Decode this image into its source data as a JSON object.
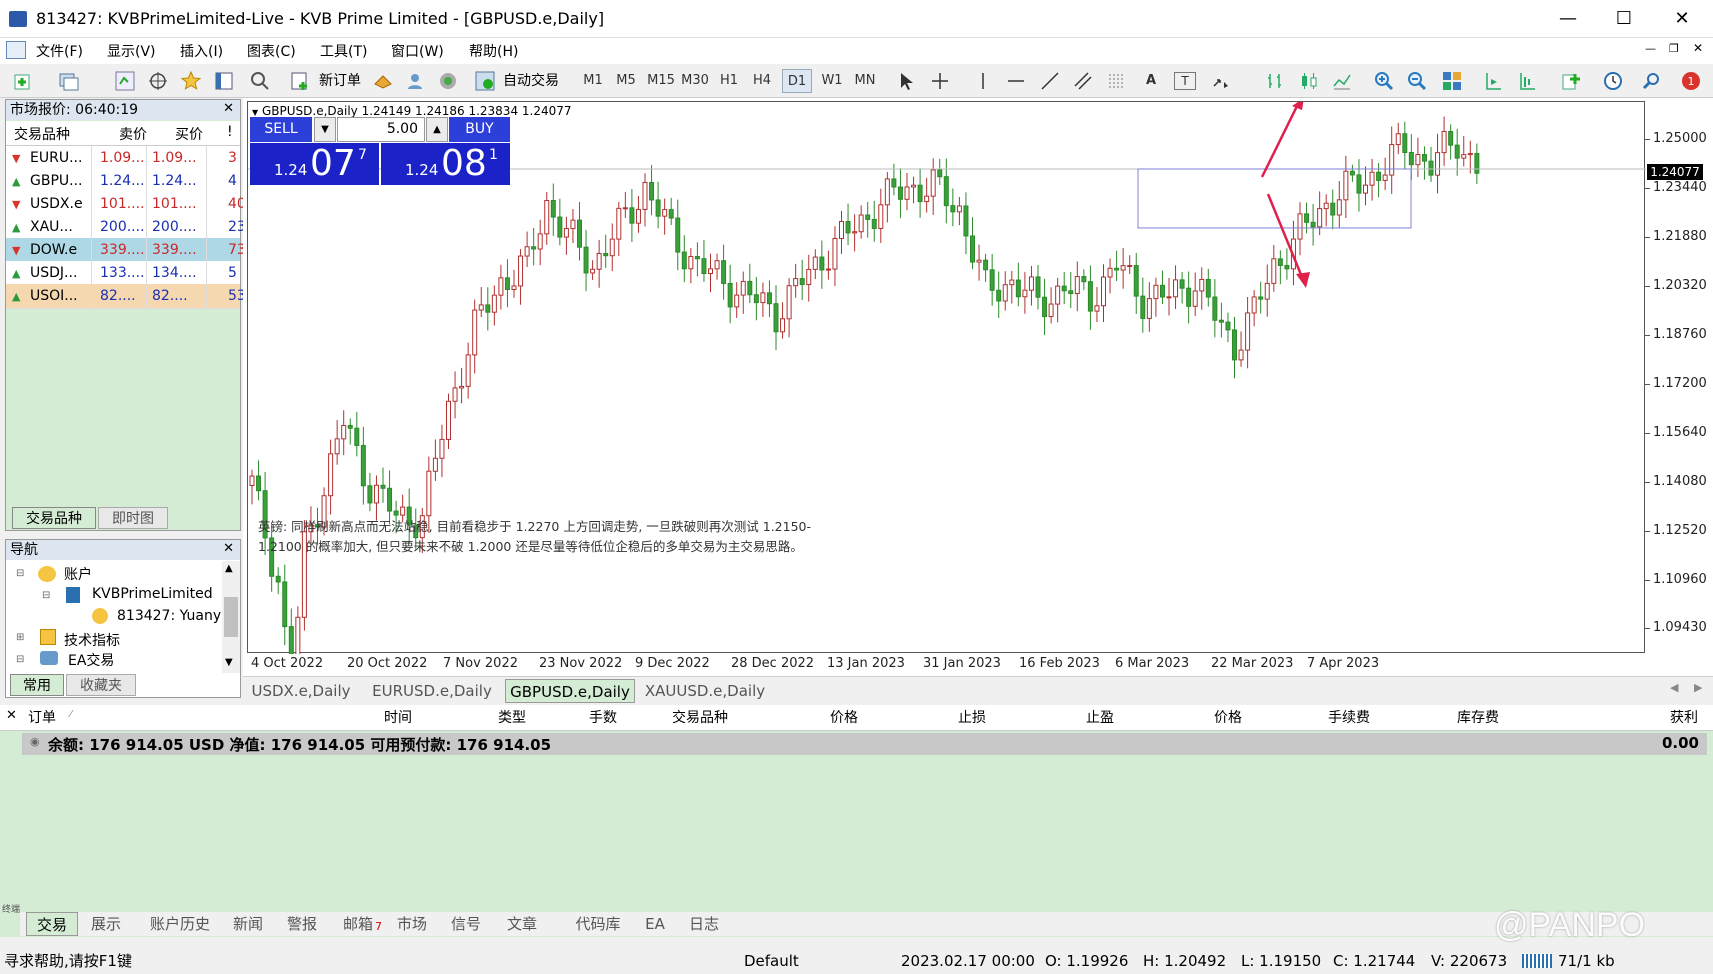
{
  "window": {
    "title": "813427: KVBPrimeLimited-Live - KVB Prime Limited - [GBPUSD.e,Daily]"
  },
  "menu": [
    "文件(F)",
    "显示(V)",
    "插入(I)",
    "图表(C)",
    "工具(T)",
    "窗口(W)",
    "帮助(H)"
  ],
  "toolbar": {
    "new_order": "新订单",
    "auto_trade": "自动交易",
    "timeframes": [
      "M1",
      "M5",
      "M15",
      "M30",
      "H1",
      "H4",
      "D1",
      "W1",
      "MN"
    ],
    "active_tf": "D1"
  },
  "market_watch": {
    "title": "市场报价: 06:40:19",
    "headers": [
      "交易品种",
      "卖价",
      "买价",
      "!"
    ],
    "rows": [
      {
        "sym": "EURU...",
        "bid": "1.09...",
        "ask": "1.09...",
        "spread": "3",
        "dir": "down",
        "bg": ""
      },
      {
        "sym": "GBPU...",
        "bid": "1.24...",
        "ask": "1.24...",
        "spread": "4",
        "dir": "up",
        "bg": ""
      },
      {
        "sym": "USDX.e",
        "bid": "101....",
        "ask": "101....",
        "spread": "40",
        "dir": "down",
        "bg": ""
      },
      {
        "sym": "XAU...",
        "bid": "200....",
        "ask": "200....",
        "spread": "23",
        "dir": "up",
        "bg": ""
      },
      {
        "sym": "DOW.e",
        "bid": "339....",
        "ask": "339....",
        "spread": "73",
        "dir": "down",
        "bg": "#aed8e6"
      },
      {
        "sym": "USDJ...",
        "bid": "133....",
        "ask": "134....",
        "spread": "5",
        "dir": "up",
        "bg": ""
      },
      {
        "sym": "USOI...",
        "bid": "82....",
        "ask": "82....",
        "spread": "53",
        "dir": "up",
        "bg": "#f5d8b0"
      }
    ],
    "tabs": [
      "交易品种",
      "即时图"
    ]
  },
  "navigator": {
    "title": "导航",
    "items": [
      "账户",
      "KVBPrimeLimited",
      "813427: Yuany",
      "技术指标",
      "EA交易"
    ],
    "tabs": [
      "常用",
      "收藏夹"
    ]
  },
  "chart": {
    "header": "GBPUSD.e,Daily  1.24149 1.24186 1.23834 1.24077",
    "sell_label": "SELL",
    "buy_label": "BUY",
    "lot": "5.00",
    "sell_small": "1.24",
    "sell_big": "07",
    "sell_sup": "7",
    "buy_small": "1.24",
    "buy_big": "08",
    "buy_sup": "1",
    "current_price": "1.24077",
    "note": "英镑: 同样刷新高点而无法站稳, 目前看稳步于 1.2270 上方回调走势, 一旦跌破则再次测试 1.2150-1.2100 的概率加大, 但只要未来不破 1.2000 还是尽量等待低位企稳后的多单交易为主交易思路。",
    "price_labels": [
      "1.25000",
      "1.23440",
      "1.21880",
      "1.20320",
      "1.18760",
      "1.17200",
      "1.15640",
      "1.14080",
      "1.12520",
      "1.10960",
      "1.09430"
    ],
    "date_labels": [
      "4 Oct 2022",
      "20 Oct 2022",
      "7 Nov 2022",
      "23 Nov 2022",
      "9 Dec 2022",
      "28 Dec 2022",
      "13 Jan 2023",
      "31 Jan 2023",
      "16 Feb 2023",
      "6 Mar 2023",
      "22 Mar 2023",
      "7 Apr 2023"
    ]
  },
  "chart_tabs": [
    "USDX.e,Daily",
    "EURUSD.e,Daily",
    "GBPUSD.e,Daily",
    "XAUUSD.e,Daily"
  ],
  "active_chart_tab": "GBPUSD.e,Daily",
  "terminal": {
    "headers": [
      "订单",
      "时间",
      "类型",
      "手数",
      "交易品种",
      "价格",
      "止损",
      "止盈",
      "价格",
      "手续费",
      "库存费",
      "获利"
    ],
    "balance": "余额: 176 914.05 USD  净值: 176 914.05  可用预付款: 176 914.05",
    "profit": "0.00",
    "tabs": [
      "交易",
      "展示",
      "账户历史",
      "新闻",
      "警报",
      "邮箱",
      "市场",
      "信号",
      "文章",
      "代码库",
      "EA",
      "日志"
    ],
    "mail_count": "7",
    "side_label": "终端"
  },
  "status": {
    "help": "寻求帮助,请按F1键",
    "profile": "Default",
    "datetime": "2023.02.17 00:00",
    "open": "O: 1.19926",
    "high": "H: 1.20492",
    "low": "L: 1.19150",
    "close": "C: 1.21744",
    "volume": "V: 220673",
    "traffic": "71/1 kb"
  },
  "watermark": "@PANPO"
}
